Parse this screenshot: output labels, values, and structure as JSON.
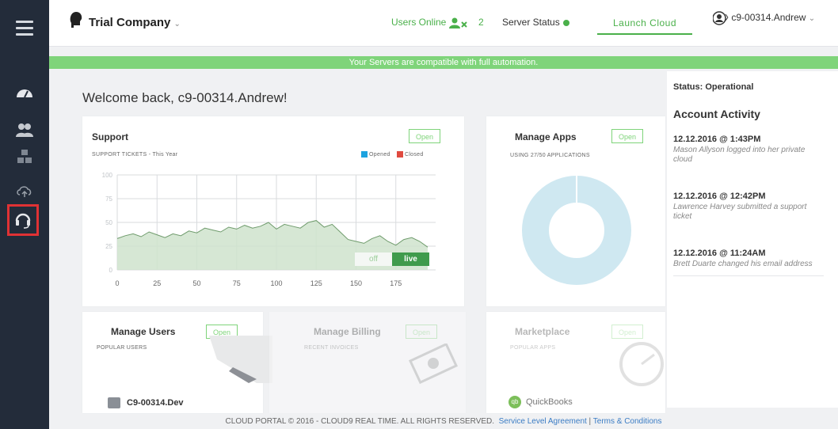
{
  "header": {
    "company": "Trial Company",
    "users_online_label": "Users Online",
    "users_online_count": "2",
    "server_status_label": "Server Status",
    "launch_label": "Launch Cloud",
    "username": "c9-00314.Andrew"
  },
  "banner": "Your Servers are compatible with full automation.",
  "welcome": "Welcome back, c9-00314.Andrew!",
  "support": {
    "title": "Support",
    "open": "Open",
    "subtitle": "SUPPORT TICKETS - This Year",
    "legend_opened": "Opened",
    "legend_closed": "Closed",
    "toggle_off": "off",
    "toggle_live": "live"
  },
  "manage_apps": {
    "title": "Manage Apps",
    "open": "Open",
    "subtitle": "USING 27/50 APPLICATIONS"
  },
  "manage_users": {
    "title": "Manage Users",
    "open": "Open",
    "subtitle": "POPULAR USERS",
    "user": "C9-00314.Dev"
  },
  "manage_billing": {
    "title": "Manage Billing",
    "open": "Open",
    "subtitle": "RECENT INVOICES"
  },
  "marketplace": {
    "title": "Marketplace",
    "open": "Open",
    "subtitle": "POPULAR APPS",
    "app": "QuickBooks"
  },
  "status": {
    "label": "Status: Operational",
    "heading": "Account Activity",
    "items": [
      {
        "date": "12.12.2016 @ 1:43PM",
        "desc": "Mason Allyson logged into her private cloud"
      },
      {
        "date": "12.12.2016 @ 12:42PM",
        "desc": "Lawrence Harvey submitted a support ticket"
      },
      {
        "date": "12.12.2016 @ 11:24AM",
        "desc": "Brett Duarte changed his email address"
      }
    ]
  },
  "footer": {
    "copyright": "CLOUD PORTAL © 2016 - CLOUD9 REAL TIME. ALL RIGHTS RESERVED.",
    "sla": "Service Level Agreement",
    "sep": " | ",
    "terms": "Terms & Conditions"
  },
  "colors": {
    "accent": "#4ab04a",
    "sidebar": "#232c3a",
    "banner": "#7fd47a",
    "highlight": "#e03234",
    "donut": "#cfe8f1"
  },
  "chart_data": {
    "type": "area",
    "ylim": [
      0,
      100
    ],
    "xlim": [
      0,
      200
    ],
    "xticks": [
      "0",
      "25",
      "50",
      "75",
      "100",
      "125",
      "150",
      "175"
    ],
    "yticks": [
      "0",
      "25",
      "50",
      "75",
      "100"
    ],
    "grid": true,
    "series": [
      {
        "name": "Opened",
        "x": [
          0,
          5,
          10,
          15,
          20,
          25,
          30,
          35,
          40,
          45,
          50,
          55,
          60,
          65,
          70,
          75,
          80,
          85,
          90,
          95,
          100,
          105,
          110,
          115,
          120,
          125,
          130,
          135,
          140,
          145,
          150,
          155,
          160,
          165,
          170,
          175,
          180,
          185,
          190,
          195
        ],
        "y": [
          33,
          36,
          38,
          35,
          40,
          37,
          34,
          38,
          36,
          41,
          39,
          44,
          42,
          40,
          45,
          43,
          47,
          44,
          46,
          50,
          43,
          48,
          46,
          44,
          50,
          52,
          45,
          48,
          40,
          32,
          30,
          28,
          33,
          36,
          30,
          26,
          32,
          34,
          30,
          24
        ]
      }
    ]
  }
}
